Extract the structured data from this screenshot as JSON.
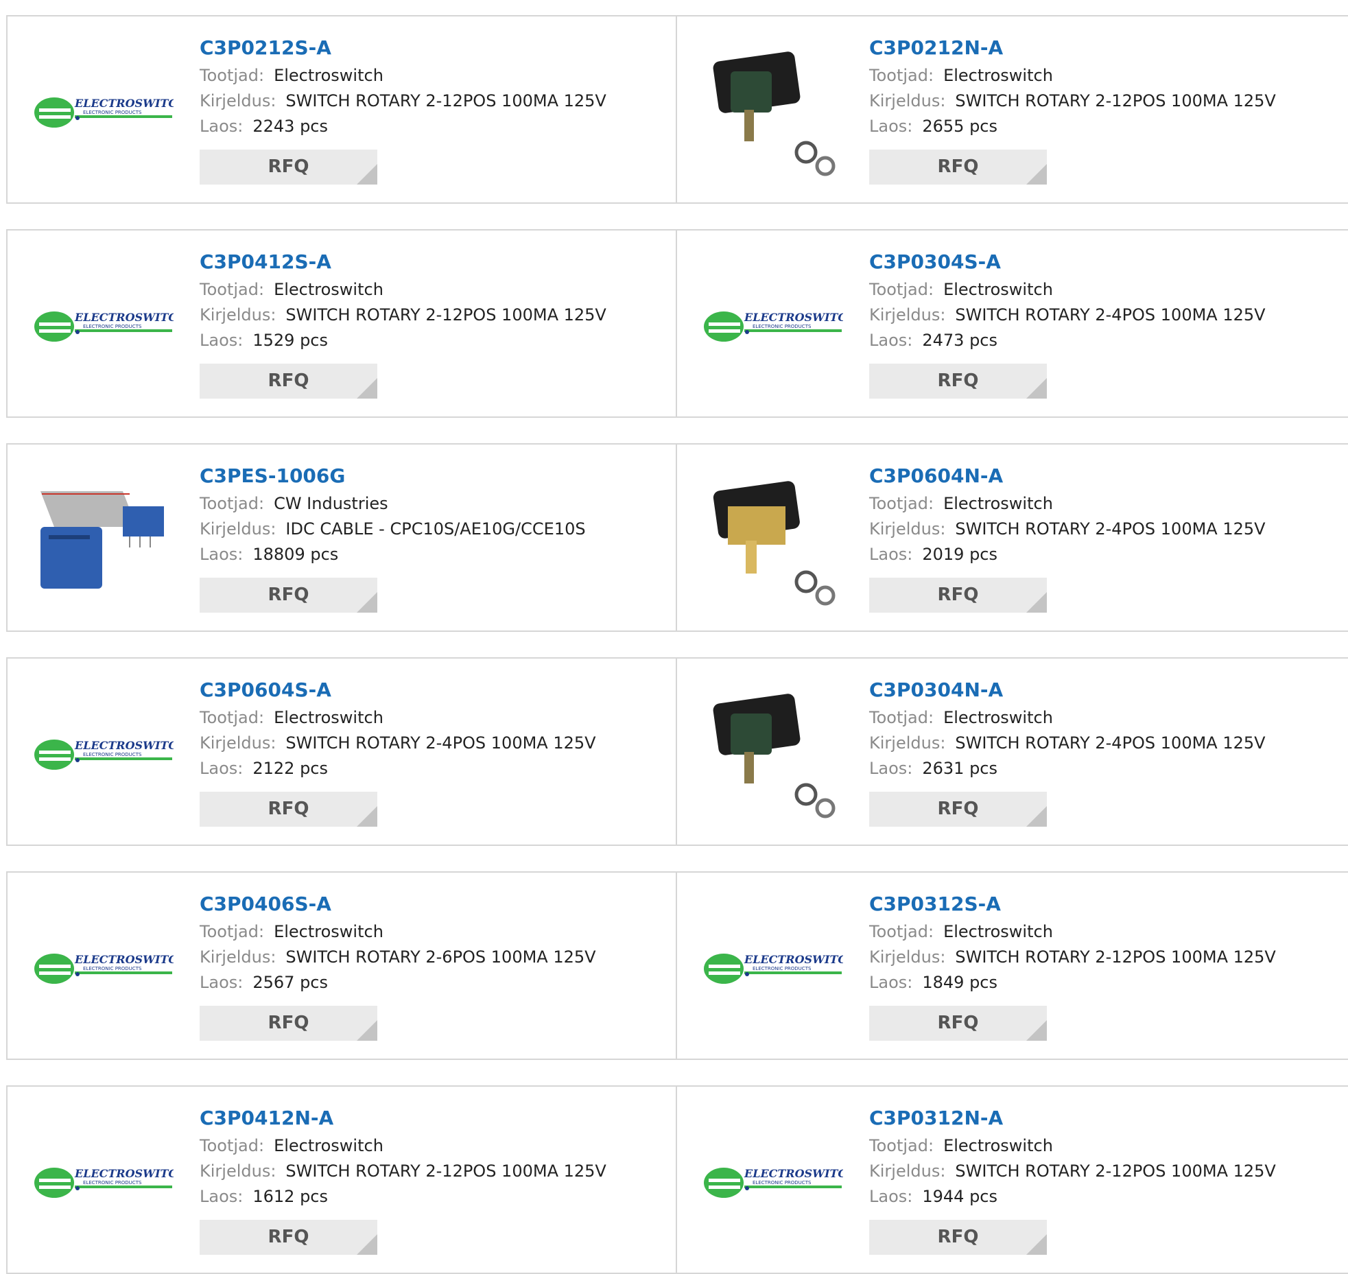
{
  "labels": {
    "maker": "Tootjad:",
    "desc": "Kirjeldus:",
    "stock": "Laos:",
    "rfq": "RFQ"
  },
  "logo_text": {
    "main": "ELECTROSWITCH",
    "sub": "ELECTRONIC PRODUCTS"
  },
  "colors": {
    "link": "#1a6cb5",
    "logo_green": "#3bb54a",
    "button_bg": "#eaeaea"
  },
  "products": [
    {
      "pn": "C3P0212S-A",
      "maker": "Electroswitch",
      "desc": "SWITCH ROTARY 2-12POS 100MA 125V",
      "stock": "2243 pcs",
      "image": "electroswitch-logo"
    },
    {
      "pn": "C3P0212N-A",
      "maker": "Electroswitch",
      "desc": "SWITCH ROTARY 2-12POS 100MA 125V",
      "stock": "2655 pcs",
      "image": "rotary-switch-photo"
    },
    {
      "pn": "C3P0412S-A",
      "maker": "Electroswitch",
      "desc": "SWITCH ROTARY 2-12POS 100MA 125V",
      "stock": "1529 pcs",
      "image": "electroswitch-logo"
    },
    {
      "pn": "C3P0304S-A",
      "maker": "Electroswitch",
      "desc": "SWITCH ROTARY 2-4POS 100MA 125V",
      "stock": "2473 pcs",
      "image": "electroswitch-logo"
    },
    {
      "pn": "C3PES-1006G",
      "maker": "CW Industries",
      "desc": "IDC CABLE - CPC10S/AE10G/CCE10S",
      "stock": "18809 pcs",
      "image": "idc-cable-photo"
    },
    {
      "pn": "C3P0604N-A",
      "maker": "Electroswitch",
      "desc": "SWITCH ROTARY 2-4POS 100MA 125V",
      "stock": "2019 pcs",
      "image": "rotary-switch-gold-photo"
    },
    {
      "pn": "C3P0604S-A",
      "maker": "Electroswitch",
      "desc": "SWITCH ROTARY 2-4POS 100MA 125V",
      "stock": "2122 pcs",
      "image": "electroswitch-logo"
    },
    {
      "pn": "C3P0304N-A",
      "maker": "Electroswitch",
      "desc": "SWITCH ROTARY 2-4POS 100MA 125V",
      "stock": "2631 pcs",
      "image": "rotary-switch-photo"
    },
    {
      "pn": "C3P0406S-A",
      "maker": "Electroswitch",
      "desc": "SWITCH ROTARY 2-6POS 100MA 125V",
      "stock": "2567 pcs",
      "image": "electroswitch-logo"
    },
    {
      "pn": "C3P0312S-A",
      "maker": "Electroswitch",
      "desc": "SWITCH ROTARY 2-12POS 100MA 125V",
      "stock": "1849 pcs",
      "image": "electroswitch-logo"
    },
    {
      "pn": "C3P0412N-A",
      "maker": "Electroswitch",
      "desc": "SWITCH ROTARY 2-12POS 100MA 125V",
      "stock": "1612 pcs",
      "image": "electroswitch-logo"
    },
    {
      "pn": "C3P0312N-A",
      "maker": "Electroswitch",
      "desc": "SWITCH ROTARY 2-12POS 100MA 125V",
      "stock": "1944 pcs",
      "image": "electroswitch-logo"
    }
  ]
}
